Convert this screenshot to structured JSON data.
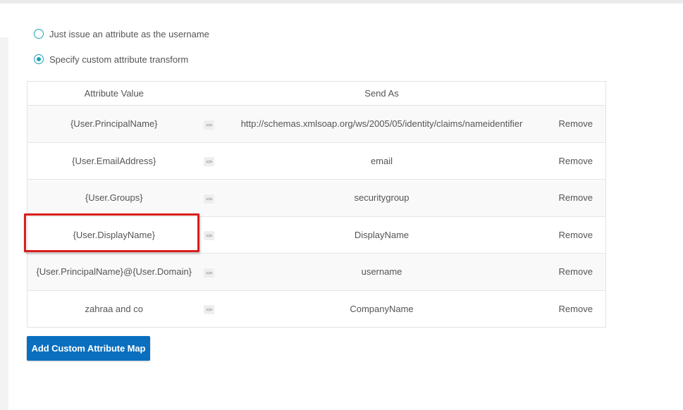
{
  "colors": {
    "accent": "#1aa3b5",
    "button": "#0a6fbf",
    "highlight": "#d91e1e"
  },
  "options": [
    {
      "label": "Just issue an attribute as the username",
      "selected": false
    },
    {
      "label": "Specify custom attribute transform",
      "selected": true
    }
  ],
  "table": {
    "headers": {
      "attribute_value": "Attribute Value",
      "send_as": "Send As"
    },
    "arrow": "=>",
    "rows": [
      {
        "attribute": "{User.PrincipalName}",
        "send_as": "http://schemas.xmlsoap.org/ws/2005/05/identity/claims/nameidentifier",
        "action": "Remove"
      },
      {
        "attribute": "{User.EmailAddress}",
        "send_as": "email",
        "action": "Remove"
      },
      {
        "attribute": "{User.Groups}",
        "send_as": "securitygroup",
        "action": "Remove"
      },
      {
        "attribute": "{User.DisplayName}",
        "send_as": "DisplayName",
        "action": "Remove",
        "highlighted": true
      },
      {
        "attribute": "{User.PrincipalName}@{User.Domain}",
        "send_as": "username",
        "action": "Remove"
      },
      {
        "attribute": "zahraa and co",
        "send_as": "CompanyName",
        "action": "Remove"
      }
    ]
  },
  "add_button_label": "Add Custom Attribute Map"
}
